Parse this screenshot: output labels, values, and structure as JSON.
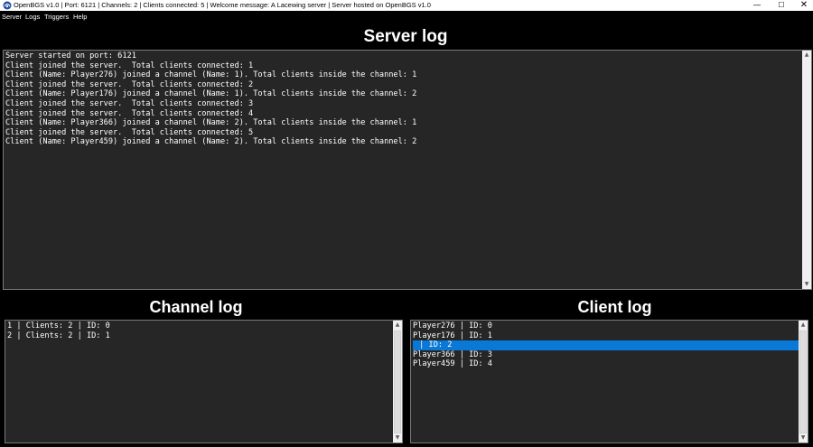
{
  "window": {
    "title": "OpenBGS v1.0 | Port: 6121 | Channels: 2 | Clients connected: 5 | Welcome message: A Lacewing server | Server hosted on OpenBGS v1.0",
    "controls": {
      "minimize": "—",
      "maximize": "☐",
      "close": "✕"
    }
  },
  "menu": {
    "items": [
      {
        "label": "Server"
      },
      {
        "label": "Logs"
      },
      {
        "label": "Triggers"
      },
      {
        "label": "Help"
      }
    ]
  },
  "server_log": {
    "heading": "Server log",
    "lines": [
      "Server started on port: 6121",
      "Client joined the server.  Total clients connected: 1",
      "Client (Name: Player276) joined a channel (Name: 1). Total clients inside the channel: 1",
      "Client joined the server.  Total clients connected: 2",
      "Client (Name: Player176) joined a channel (Name: 1). Total clients inside the channel: 2",
      "Client joined the server.  Total clients connected: 3",
      "Client joined the server.  Total clients connected: 4",
      "Client (Name: Player366) joined a channel (Name: 2). Total clients inside the channel: 1",
      "Client joined the server.  Total clients connected: 5",
      "Client (Name: Player459) joined a channel (Name: 2). Total clients inside the channel: 2"
    ]
  },
  "channel_log": {
    "heading": "Channel log",
    "lines": [
      "1 | Clients: 2 | ID: 0",
      "2 | Clients: 2 | ID: 1"
    ]
  },
  "client_log": {
    "heading": "Client log",
    "lines": [
      "Player276 | ID: 0",
      "Player176 | ID: 1",
      " | ID: 2",
      "Player366 | ID: 3",
      "Player459 | ID: 4"
    ],
    "selected_index": 2
  },
  "colors": {
    "background": "#000000",
    "pane": "#262626",
    "selection": "#0a78d7",
    "text": "#ffffff"
  }
}
